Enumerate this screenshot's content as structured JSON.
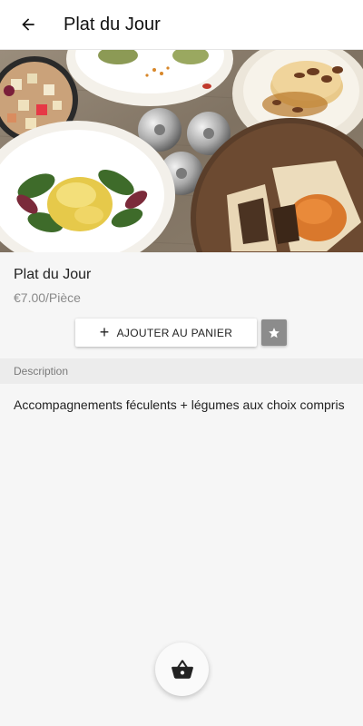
{
  "app_bar": {
    "title": "Plat du Jour",
    "back_icon": "arrow-left-icon"
  },
  "hero": {
    "alt": "food photo",
    "image": "food-platter-photo"
  },
  "product": {
    "name": "Plat du Jour",
    "price": "€7.00/Pièce"
  },
  "actions": {
    "add_to_cart_label": "AJOUTER AU PANIER",
    "add_icon": "plus-icon",
    "favorite_icon": "star-icon"
  },
  "description_section": {
    "header": "Description",
    "text": "Accompagnements féculents + légumes aux choix compris"
  },
  "basket_fab": {
    "icon": "shopping-basket-icon"
  },
  "colors": {
    "app_bar": "#ffffff",
    "background": "#f6f6f6",
    "section_header": "#ececec",
    "favorite_button": "#8c8c8c"
  }
}
